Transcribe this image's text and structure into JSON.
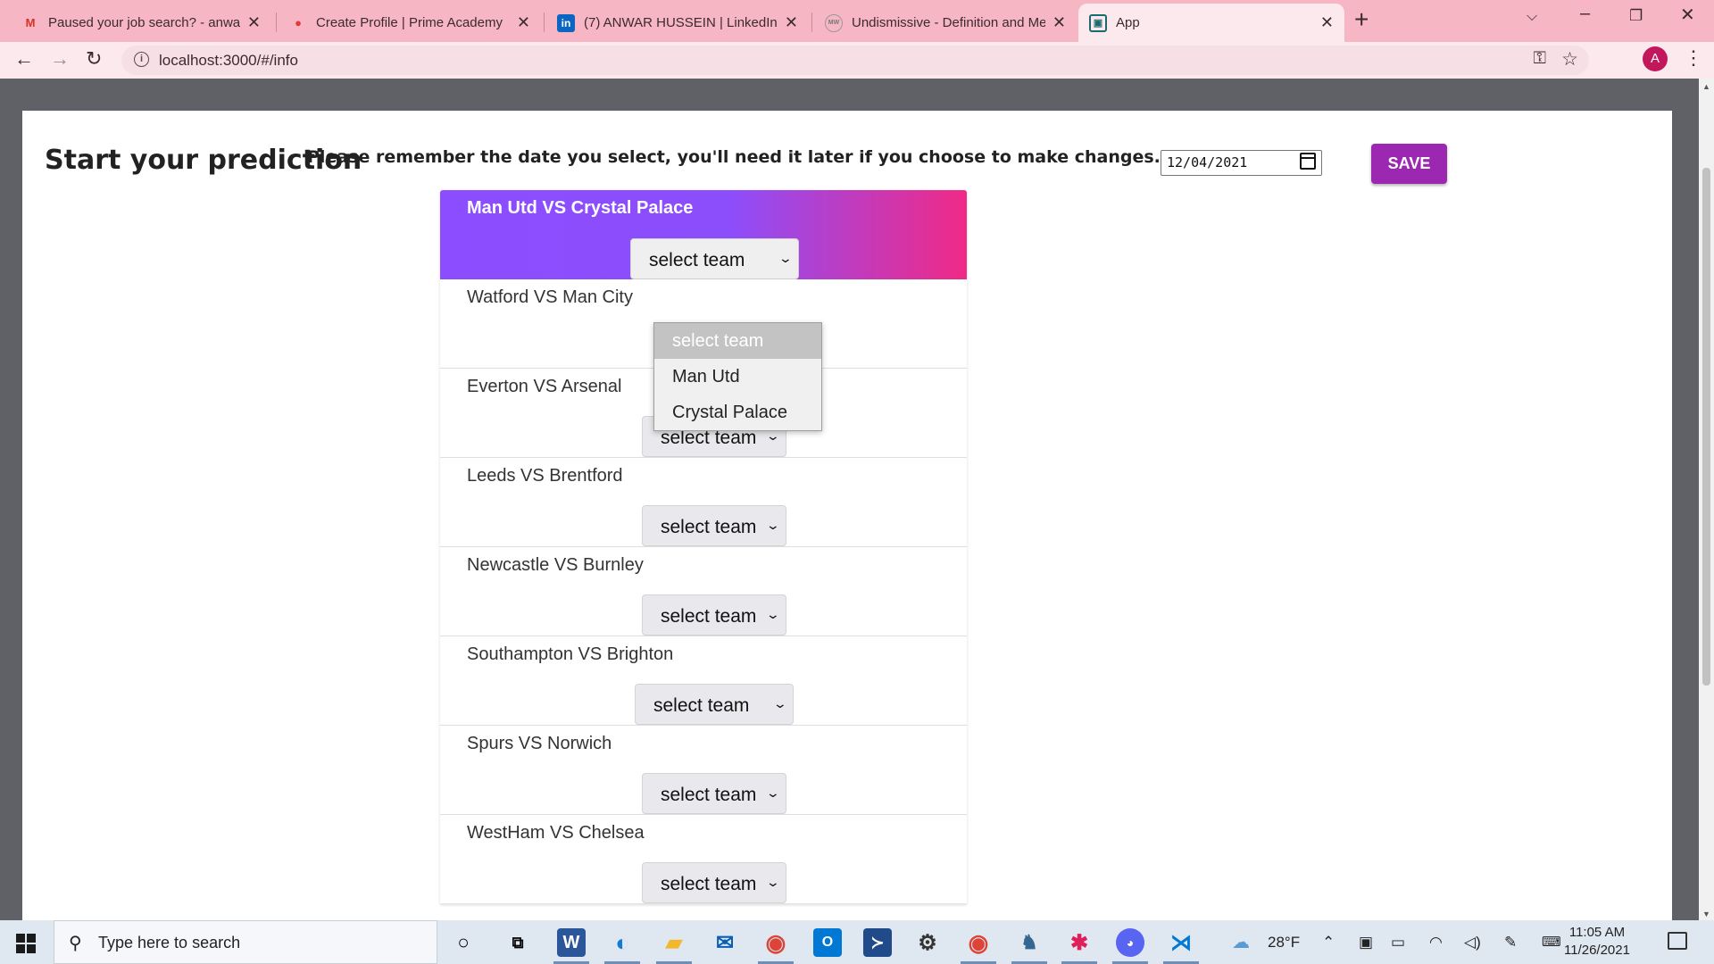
{
  "browser": {
    "tabs": [
      {
        "title": "Paused your job search? - anwar",
        "favicon": "M",
        "favicon_color": "#d93025"
      },
      {
        "title": "Create Profile | Prime Academy",
        "favicon": "●",
        "favicon_color": "#e53935"
      },
      {
        "title": "(7) ANWAR HUSSEIN | LinkedIn",
        "favicon": "in",
        "favicon_color": "#0a66c2"
      },
      {
        "title": "Undismissive - Definition and Me",
        "favicon": "MW",
        "favicon_color": "#7a7a7a"
      },
      {
        "title": "App",
        "favicon": "▣",
        "favicon_color": "#1a6b70"
      }
    ],
    "url": "localhost:3000/#/info",
    "profile_initial": "A"
  },
  "page": {
    "heading": "Start your prediction",
    "note": "Please remember the date you select, you'll need it later if you choose to make changes.",
    "date_value": "12/04/2021",
    "save_label": "SAVE",
    "select_placeholder": "select team",
    "matches": [
      {
        "title": "Man Utd VS Crystal Palace",
        "selected": "select team"
      },
      {
        "title": "Watford VS Man City",
        "selected": "select team"
      },
      {
        "title": "Everton VS Arsenal",
        "selected": "select team"
      },
      {
        "title": "Leeds VS Brentford",
        "selected": "select team"
      },
      {
        "title": "Newcastle VS Burnley",
        "selected": "select team"
      },
      {
        "title": "Southampton VS Brighton",
        "selected": "select team"
      },
      {
        "title": "Spurs VS Norwich",
        "selected": "select team"
      },
      {
        "title": "WestHam VS Chelsea",
        "selected": "select team"
      }
    ],
    "open_dropdown": {
      "options": [
        "select team",
        "Man Utd",
        "Crystal Palace"
      ],
      "highlighted": "select team"
    }
  },
  "taskbar": {
    "search_placeholder": "Type here to search",
    "temperature": "28°F",
    "time": "11:05 AM",
    "date": "11/26/2021"
  },
  "colors": {
    "accent": "#9c27b0",
    "header_gradient_start": "#8b4dff",
    "header_gradient_end": "#f02a86",
    "chrome_tab_bg": "#f6b6c3"
  }
}
